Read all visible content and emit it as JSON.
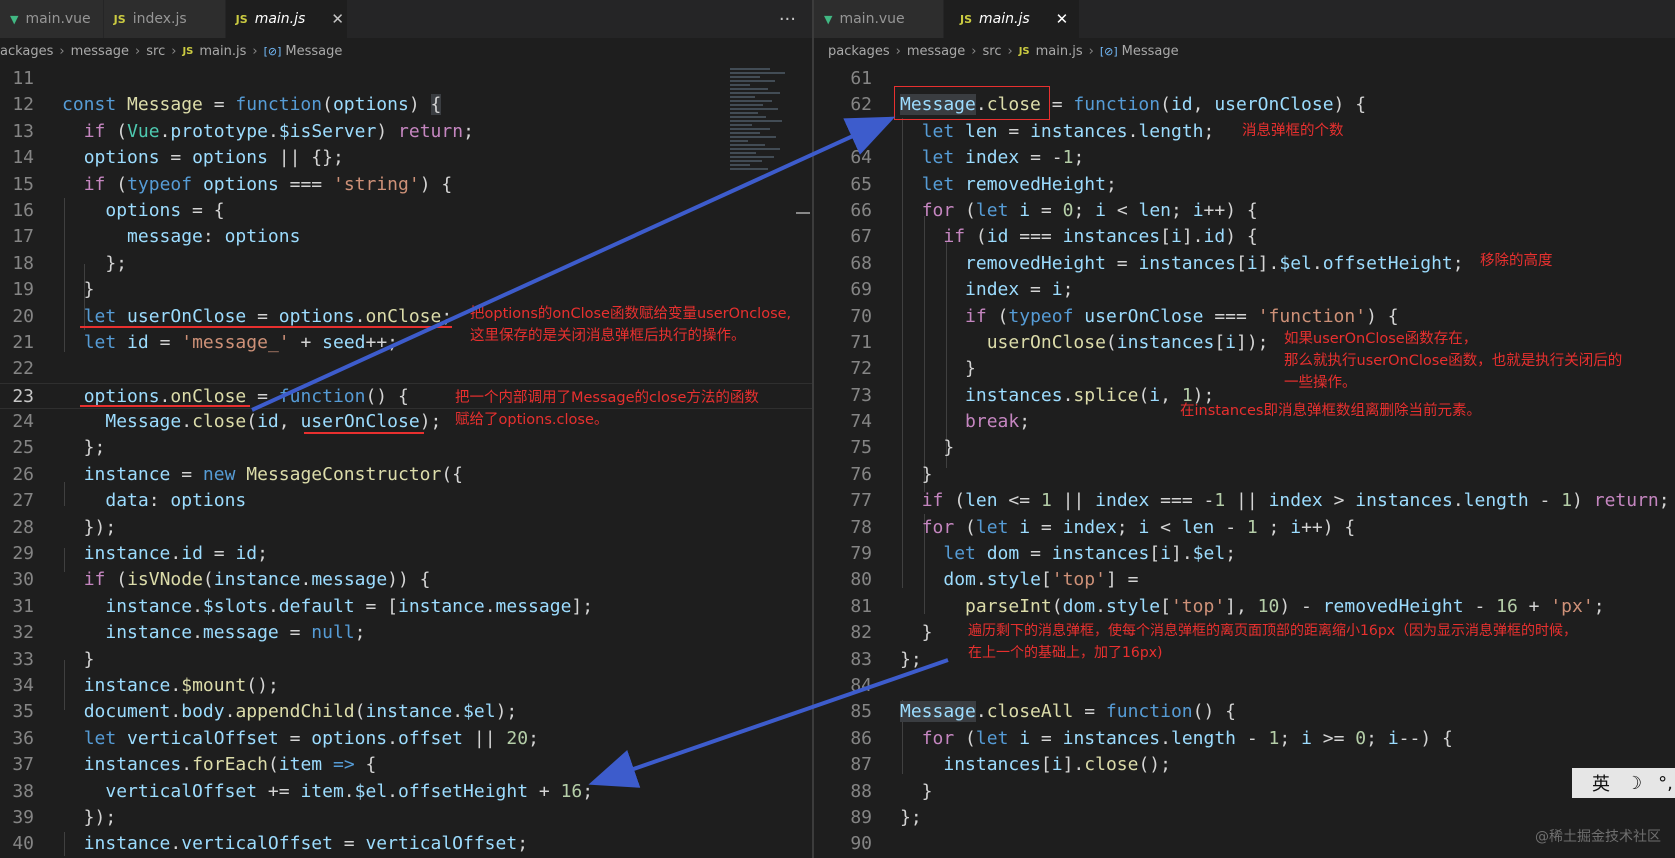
{
  "left_pane": {
    "tabs": [
      {
        "label": "main.vue",
        "icon": "vue-icon",
        "active": false
      },
      {
        "label": "index.js",
        "icon": "JS",
        "active": false
      },
      {
        "label": "main.js",
        "icon": "JS",
        "active": true
      }
    ],
    "more_label": "···",
    "breadcrumb": [
      "ackages",
      "message",
      "src",
      "main.js",
      "Message"
    ],
    "file_icon": "JS",
    "symbol_icon": "[⊘]",
    "line_numbers": [
      "11",
      "12",
      "13",
      "14",
      "15",
      "16",
      "17",
      "18",
      "19",
      "20",
      "21",
      "22",
      "23",
      "24",
      "25",
      "26",
      "27",
      "28",
      "29",
      "30",
      "31",
      "32",
      "33",
      "34",
      "35",
      "36",
      "37",
      "38",
      "39",
      "40"
    ],
    "current_line": "23"
  },
  "right_pane": {
    "tabs": [
      {
        "label": "main.vue",
        "icon": "vue-icon",
        "active": false
      },
      {
        "label": "main.js",
        "icon": "JS",
        "active": true
      }
    ],
    "close_label": "✕",
    "breadcrumb": [
      "packages",
      "message",
      "src",
      "main.js",
      "Message"
    ],
    "file_icon": "JS",
    "symbol_icon": "[⊘]",
    "line_numbers": [
      "61",
      "62",
      "63",
      "64",
      "65",
      "66",
      "67",
      "68",
      "69",
      "70",
      "71",
      "72",
      "73",
      "74",
      "75",
      "76",
      "77",
      "78",
      "79",
      "80",
      "81",
      "82",
      "83",
      "84",
      "85",
      "86",
      "87",
      "88",
      "89",
      "90"
    ]
  },
  "annotations": {
    "a1_line1": "把options的onClose函数赋给变量userOnclose,",
    "a1_line2": "这里保存的是关闭消息弹框后执行的操作。",
    "a2_line1": "把一个内部调用了Message的close方法的函数",
    "a2_line2": "赋给了options.close。",
    "a3": "消息弹框的个数",
    "a4": "移除的高度",
    "a5_line1": "如果userOnClose函数存在，",
    "a5_line2": "那么就执行userOnClose函数，也就是执行关闭后的",
    "a5_line3": "一些操作。",
    "a6": "在instances即消息弹框数组离删除当前元素。",
    "a7_line1": "遍历剩下的消息弹框，使每个消息弹框的离页面顶部的距离缩小16px（因为显示消息弹框的时候，",
    "a7_line2": "在上一个的基础上，加了16px)"
  },
  "ime": {
    "lang": "英",
    "moon": "☽",
    "punct": "°,"
  },
  "watermark": "@稀土掘金技术社区",
  "colors": {
    "annotation": "#e8302f",
    "arrow": "#3d5ccc",
    "editor_bg": "#1e1e1e",
    "keyword": "#569cd6",
    "function": "#dcdcaa",
    "variable": "#9cdcfe",
    "string": "#ce9178",
    "number": "#b5cea8",
    "type": "#4ec9b0"
  }
}
